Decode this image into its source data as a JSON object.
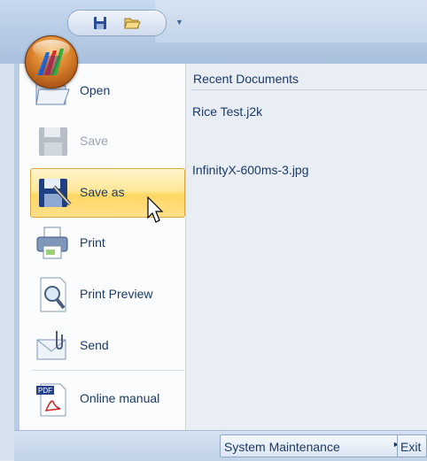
{
  "menu": {
    "items": [
      {
        "label": "Open",
        "icon": "folder-open-icon",
        "enabled": true
      },
      {
        "label": "Save",
        "icon": "floppy-disk-icon",
        "enabled": false
      },
      {
        "label": "Save as",
        "icon": "save-as-icon",
        "enabled": true,
        "highlighted": true
      },
      {
        "label": "Print",
        "icon": "printer-icon",
        "enabled": true
      },
      {
        "label": "Print Preview",
        "icon": "print-preview-icon",
        "enabled": true
      },
      {
        "label": "Send",
        "icon": "mail-send-icon",
        "enabled": true
      },
      {
        "label": "Online manual",
        "icon": "pdf-manual-icon",
        "enabled": true
      }
    ]
  },
  "recent": {
    "header": "Recent Documents",
    "items": [
      "Rice Test.j2k",
      "InfinityX-600ms-3.jpg"
    ]
  },
  "footer": {
    "system_maintenance": "System Maintenance",
    "exit": "Exit"
  },
  "colors": {
    "accent_highlight": "#ffd764",
    "text": "#1b3a65",
    "orb": "#d9802a"
  }
}
